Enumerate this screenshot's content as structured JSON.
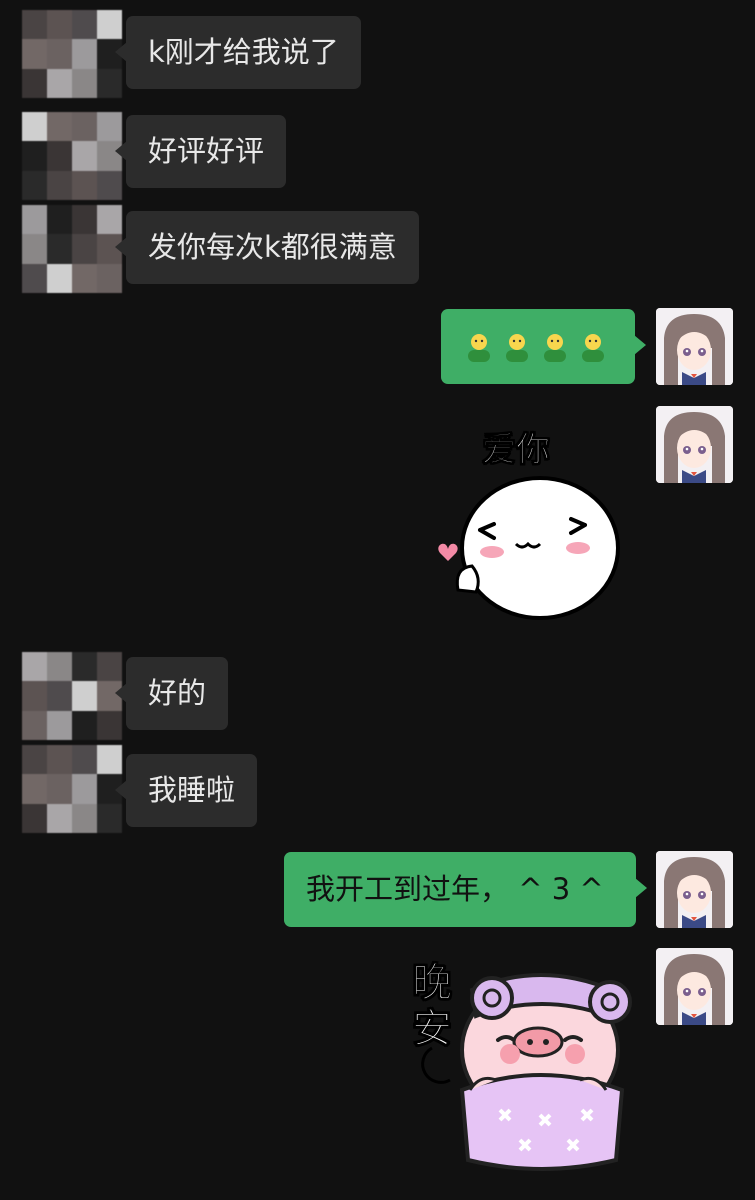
{
  "messages": {
    "m1": {
      "sender": "other",
      "text": "k刚才给我说了"
    },
    "m2": {
      "sender": "other",
      "text": "好评好评"
    },
    "m3": {
      "sender": "other",
      "text": "发你每次k都很满意"
    },
    "m4": {
      "sender": "me",
      "emoji": [
        "green-person-emoji",
        "green-person-emoji",
        "green-person-emoji",
        "green-person-emoji"
      ]
    },
    "m5": {
      "sender": "me",
      "sticker": "love-you-sticker",
      "caption": "爱你"
    },
    "m6": {
      "sender": "other",
      "text": "好的"
    },
    "m7": {
      "sender": "other",
      "text": "我睡啦"
    },
    "m8": {
      "sender": "me",
      "text": "我开工到过年，  ^ 3 ^"
    },
    "m9": {
      "sender": "me",
      "sticker": "good-night-pig-sticker",
      "caption_line1": "晚",
      "caption_line2": "安"
    }
  },
  "colors": {
    "background": "#111111",
    "incoming_bubble": "#2c2c2c",
    "outgoing_bubble": "#3fae66",
    "incoming_text": "#e8e8e8",
    "outgoing_text": "#111111"
  }
}
